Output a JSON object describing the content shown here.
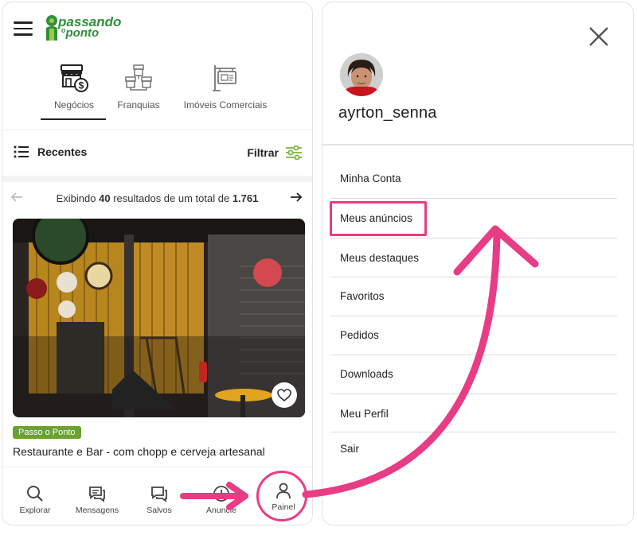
{
  "header": {
    "logo_line1": "passando",
    "logo_line2_small": "o",
    "logo_line2": "ponto"
  },
  "categories": [
    {
      "label": "Negócios",
      "icon": "store-dollar-icon",
      "active": true
    },
    {
      "label": "Franquias",
      "icon": "franchise-stores-icon",
      "active": false
    },
    {
      "label": "Imóveis Comerciais",
      "icon": "commercial-property-sign-icon",
      "active": false
    }
  ],
  "toolbar": {
    "recentes_label": "Recentes",
    "filtrar_label": "Filtrar"
  },
  "pagination": {
    "prefix": "Exibindo",
    "shown": "40",
    "middle": "resultados de um total de",
    "total": "1.761"
  },
  "listing": {
    "badge": "Passo o Ponto",
    "title": "Restaurante e Bar - com chopp e cerveja artesanal"
  },
  "bottom_nav": [
    {
      "label": "Explorar",
      "icon": "search-icon"
    },
    {
      "label": "Mensagens",
      "icon": "messages-icon"
    },
    {
      "label": "Salvos",
      "icon": "saved-icon"
    },
    {
      "label": "Anuncie",
      "icon": "add-circle-icon"
    },
    {
      "label": "Painel",
      "icon": "user-icon"
    }
  ],
  "profile": {
    "username": "ayrton_senna"
  },
  "menu": [
    {
      "label": "Minha Conta"
    },
    {
      "label": "Meus anúncios"
    },
    {
      "label": "Meus destaques"
    },
    {
      "label": "Favoritos"
    },
    {
      "label": "Pedidos"
    },
    {
      "label": "Downloads"
    },
    {
      "label": "Meu Perfil"
    },
    {
      "label": "Sair"
    }
  ],
  "colors": {
    "accent_pink": "#e83c84",
    "badge_green": "#6aa12f",
    "filter_green": "#7cb342"
  }
}
